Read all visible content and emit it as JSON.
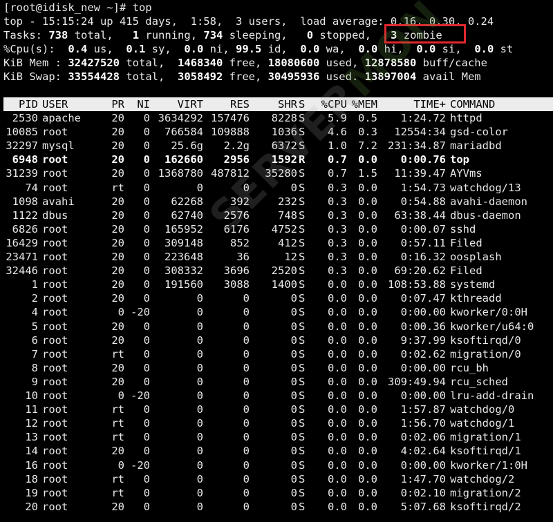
{
  "window": {
    "prompt": "[root@idisk_new ~]# top"
  },
  "summary": {
    "uptime_line": "top - 15:15:24 up 415 days,  1:58,  3 users,  load average: 0.16, 0.30, 0.24",
    "tasks": {
      "label": "Tasks:",
      "total": "738",
      "total_label": "total,",
      "running": "1",
      "running_label": "running,",
      "sleeping": "734",
      "sleeping_label": "sleeping,",
      "stopped": "0",
      "stopped_label": "stopped,",
      "zombie": "3",
      "zombie_label": "zombie"
    },
    "cpu": {
      "label": "%Cpu(s):",
      "us": "0.4",
      "sy": "0.1",
      "ni": "0.0",
      "id": "99.5",
      "wa": "0.0",
      "hi": "0.0",
      "si": "0.0",
      "st": "0.0"
    },
    "mem": {
      "label": "KiB Mem :",
      "total": "32427520",
      "free": "1468340",
      "used": "18080600",
      "buff_cache": "12878580"
    },
    "swap": {
      "label": "KiB Swap:",
      "total": "33554428",
      "free": "3058492",
      "used": "30495936",
      "avail": "13897004"
    }
  },
  "highlight_color": "#e0282e",
  "watermark": {
    "part1": "SERVER",
    "part2": "MON"
  },
  "table": {
    "columns": [
      "PID",
      "USER",
      "PR",
      "NI",
      "VIRT",
      "RES",
      "SHR",
      "S",
      "%CPU",
      "%MEM",
      "TIME+",
      "COMMAND"
    ],
    "rows": [
      [
        "2530",
        "apache",
        "20",
        "0",
        "3634292",
        "157476",
        "8228",
        "S",
        "5.9",
        "0.5",
        "1:24.72",
        "httpd"
      ],
      [
        "10085",
        "root",
        "20",
        "0",
        "766584",
        "109888",
        "1036",
        "S",
        "4.6",
        "0.3",
        "12554:34",
        "gsd-color"
      ],
      [
        "32297",
        "mysql",
        "20",
        "0",
        "25.6g",
        "2.2g",
        "6372",
        "S",
        "1.0",
        "7.2",
        "231:34.87",
        "mariadbd"
      ],
      [
        "6948",
        "root",
        "20",
        "0",
        "162660",
        "2956",
        "1592",
        "R",
        "0.7",
        "0.0",
        "0:00.76",
        "top"
      ],
      [
        "31239",
        "root",
        "20",
        "0",
        "1368780",
        "487812",
        "35280",
        "S",
        "0.7",
        "1.5",
        "11:39.47",
        "AYVms"
      ],
      [
        "74",
        "root",
        "rt",
        "0",
        "0",
        "0",
        "0",
        "S",
        "0.3",
        "0.0",
        "1:54.73",
        "watchdog/13"
      ],
      [
        "1098",
        "avahi",
        "20",
        "0",
        "62268",
        "392",
        "232",
        "S",
        "0.3",
        "0.0",
        "0:54.88",
        "avahi-daemon"
      ],
      [
        "1122",
        "dbus",
        "20",
        "0",
        "62740",
        "2576",
        "748",
        "S",
        "0.3",
        "0.0",
        "63:38.44",
        "dbus-daemon"
      ],
      [
        "6826",
        "root",
        "20",
        "0",
        "165952",
        "6176",
        "4752",
        "S",
        "0.3",
        "0.0",
        "0:00.07",
        "sshd"
      ],
      [
        "16429",
        "root",
        "20",
        "0",
        "309148",
        "852",
        "412",
        "S",
        "0.3",
        "0.0",
        "0:57.11",
        "Filed"
      ],
      [
        "23471",
        "root",
        "20",
        "0",
        "223648",
        "36",
        "12",
        "S",
        "0.3",
        "0.0",
        "0:16.32",
        "oosplash"
      ],
      [
        "32446",
        "root",
        "20",
        "0",
        "308332",
        "3696",
        "2520",
        "S",
        "0.3",
        "0.0",
        "69:20.62",
        "Filed"
      ],
      [
        "1",
        "root",
        "20",
        "0",
        "191560",
        "3088",
        "1400",
        "S",
        "0.0",
        "0.0",
        "108:53.88",
        "systemd"
      ],
      [
        "2",
        "root",
        "20",
        "0",
        "0",
        "0",
        "0",
        "S",
        "0.0",
        "0.0",
        "0:07.47",
        "kthreadd"
      ],
      [
        "4",
        "root",
        "0",
        "-20",
        "0",
        "0",
        "0",
        "S",
        "0.0",
        "0.0",
        "0:00.00",
        "kworker/0:0H"
      ],
      [
        "5",
        "root",
        "20",
        "0",
        "0",
        "0",
        "0",
        "S",
        "0.0",
        "0.0",
        "0:00.36",
        "kworker/u64:0"
      ],
      [
        "6",
        "root",
        "20",
        "0",
        "0",
        "0",
        "0",
        "S",
        "0.0",
        "0.0",
        "9:37.99",
        "ksoftirqd/0"
      ],
      [
        "7",
        "root",
        "rt",
        "0",
        "0",
        "0",
        "0",
        "S",
        "0.0",
        "0.0",
        "0:02.62",
        "migration/0"
      ],
      [
        "8",
        "root",
        "20",
        "0",
        "0",
        "0",
        "0",
        "S",
        "0.0",
        "0.0",
        "0:00.00",
        "rcu_bh"
      ],
      [
        "9",
        "root",
        "20",
        "0",
        "0",
        "0",
        "0",
        "S",
        "0.0",
        "0.0",
        "309:49.94",
        "rcu_sched"
      ],
      [
        "10",
        "root",
        "0",
        "-20",
        "0",
        "0",
        "0",
        "S",
        "0.0",
        "0.0",
        "0:00.00",
        "lru-add-drain"
      ],
      [
        "11",
        "root",
        "rt",
        "0",
        "0",
        "0",
        "0",
        "S",
        "0.0",
        "0.0",
        "1:57.87",
        "watchdog/0"
      ],
      [
        "12",
        "root",
        "rt",
        "0",
        "0",
        "0",
        "0",
        "S",
        "0.0",
        "0.0",
        "1:56.70",
        "watchdog/1"
      ],
      [
        "13",
        "root",
        "rt",
        "0",
        "0",
        "0",
        "0",
        "S",
        "0.0",
        "0.0",
        "0:02.06",
        "migration/1"
      ],
      [
        "14",
        "root",
        "20",
        "0",
        "0",
        "0",
        "0",
        "S",
        "0.0",
        "0.0",
        "4:02.64",
        "ksoftirqd/1"
      ],
      [
        "16",
        "root",
        "0",
        "-20",
        "0",
        "0",
        "0",
        "S",
        "0.0",
        "0.0",
        "0:00.00",
        "kworker/1:0H"
      ],
      [
        "18",
        "root",
        "rt",
        "0",
        "0",
        "0",
        "0",
        "S",
        "0.0",
        "0.0",
        "1:47.70",
        "watchdog/2"
      ],
      [
        "19",
        "root",
        "rt",
        "0",
        "0",
        "0",
        "0",
        "S",
        "0.0",
        "0.0",
        "0:02.10",
        "migration/2"
      ],
      [
        "20",
        "root",
        "20",
        "0",
        "0",
        "0",
        "0",
        "S",
        "0.0",
        "0.0",
        "5:07.68",
        "ksoftirqd/2"
      ]
    ],
    "bold_row_index": 3
  }
}
